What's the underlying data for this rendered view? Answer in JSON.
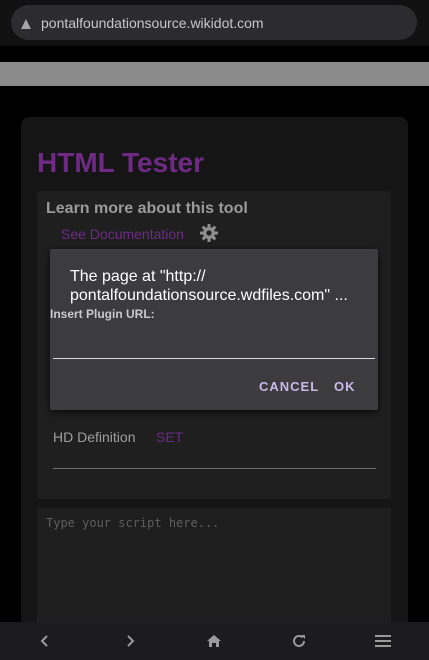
{
  "browser": {
    "url": "pontalfoundationsource.wikidot.com"
  },
  "page": {
    "title": "HTML Tester",
    "learn_title": "Learn more about this tool",
    "doc_link": "See Documentation",
    "hd_label": "HD Definition",
    "set_label": "SET",
    "script_placeholder": "Type your script here..."
  },
  "dialog": {
    "title_line1": "The page at \"http://",
    "title_line2": "pontalfoundationsource.wdfiles.com\" ...",
    "message": "Insert Plugin URL:",
    "input_value": "",
    "cancel_label": "CANCEL",
    "ok_label": "OK"
  },
  "nav": {
    "icons": [
      "back-icon",
      "forward-icon",
      "home-icon",
      "reload-icon",
      "menu-icon"
    ]
  },
  "colors": {
    "accent_purple": "#6f2a86",
    "dialog_button": "#c9b8ea",
    "dialog_bg": "#3c3c3e"
  }
}
